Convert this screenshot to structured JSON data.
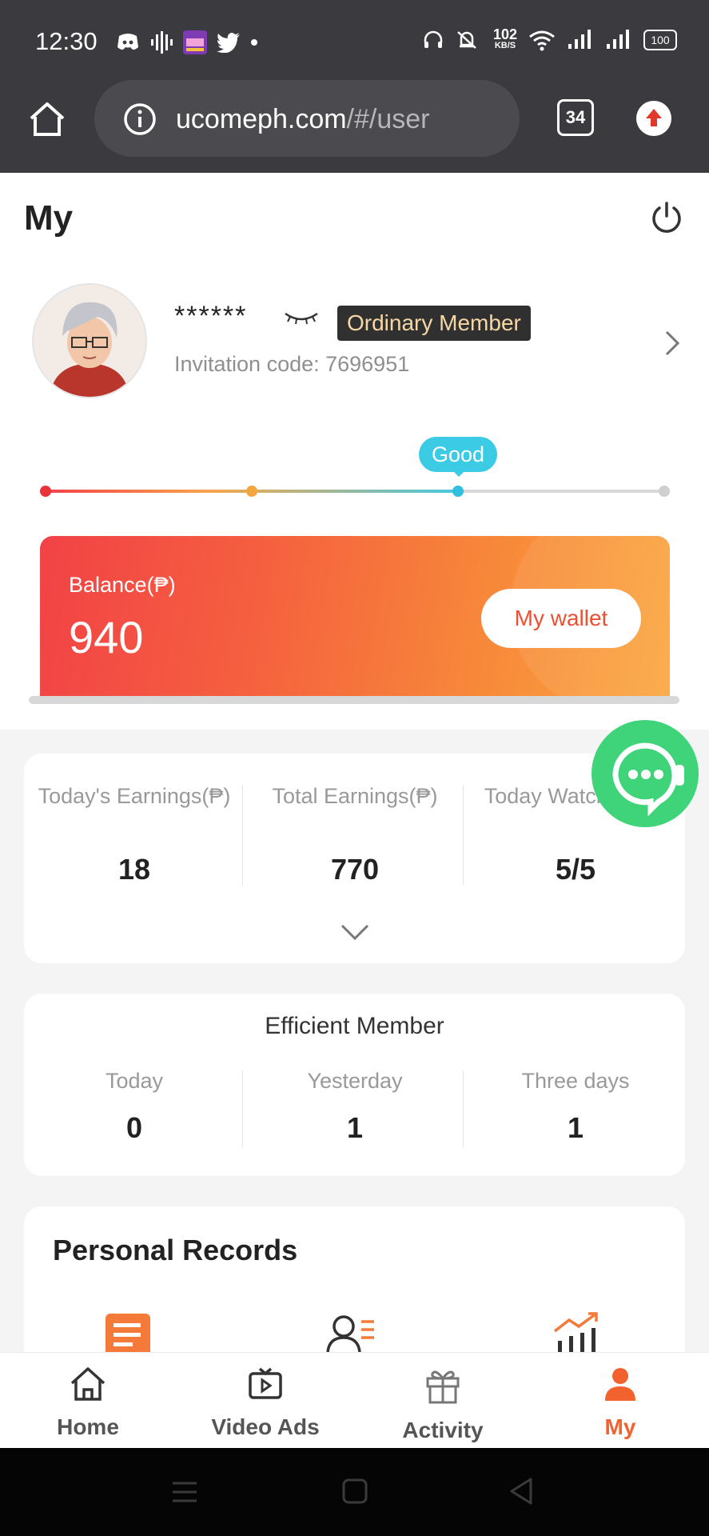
{
  "status_bar": {
    "time": "12:30",
    "net_speed_top": "102",
    "net_speed_unit": "KB/S",
    "battery": "100"
  },
  "browser": {
    "url_host": "ucomeph.com",
    "url_path": "/#/user",
    "tab_count": "34"
  },
  "header": {
    "title": "My"
  },
  "profile": {
    "name_masked": "******",
    "member_level": "Ordinary Member",
    "invitation_label": "Invitation code: 7696951"
  },
  "level_progress": {
    "current_label": "Good",
    "fraction": 0.6667,
    "colors": {
      "start": "#f2414a",
      "mid": "#f7a64b",
      "current": "#48c8e2",
      "empty": "#d8d8d8"
    }
  },
  "balance": {
    "label": "Balance(₱)",
    "value": "940",
    "wallet_button": "My wallet"
  },
  "stats": [
    {
      "label": "Today's Earnings(₱)",
      "value": "18"
    },
    {
      "label": "Total Earnings(₱)",
      "value": "770"
    },
    {
      "label": "Today Watch(PCS)",
      "value": "5/5"
    }
  ],
  "efficient_member": {
    "title": "Efficient Member",
    "items": [
      {
        "label": "Today",
        "value": "0"
      },
      {
        "label": "Yesterday",
        "value": "1"
      },
      {
        "label": "Three days",
        "value": "1"
      }
    ]
  },
  "personal_records": {
    "title": "Personal Records"
  },
  "bottom_nav": [
    {
      "label": "Home",
      "icon": "home-icon"
    },
    {
      "label": "Video Ads",
      "icon": "video-icon"
    },
    {
      "label": "Activity",
      "icon": "gift-icon"
    },
    {
      "label": "My",
      "icon": "user-icon",
      "active": true
    }
  ],
  "accent_color": "#f1622e"
}
